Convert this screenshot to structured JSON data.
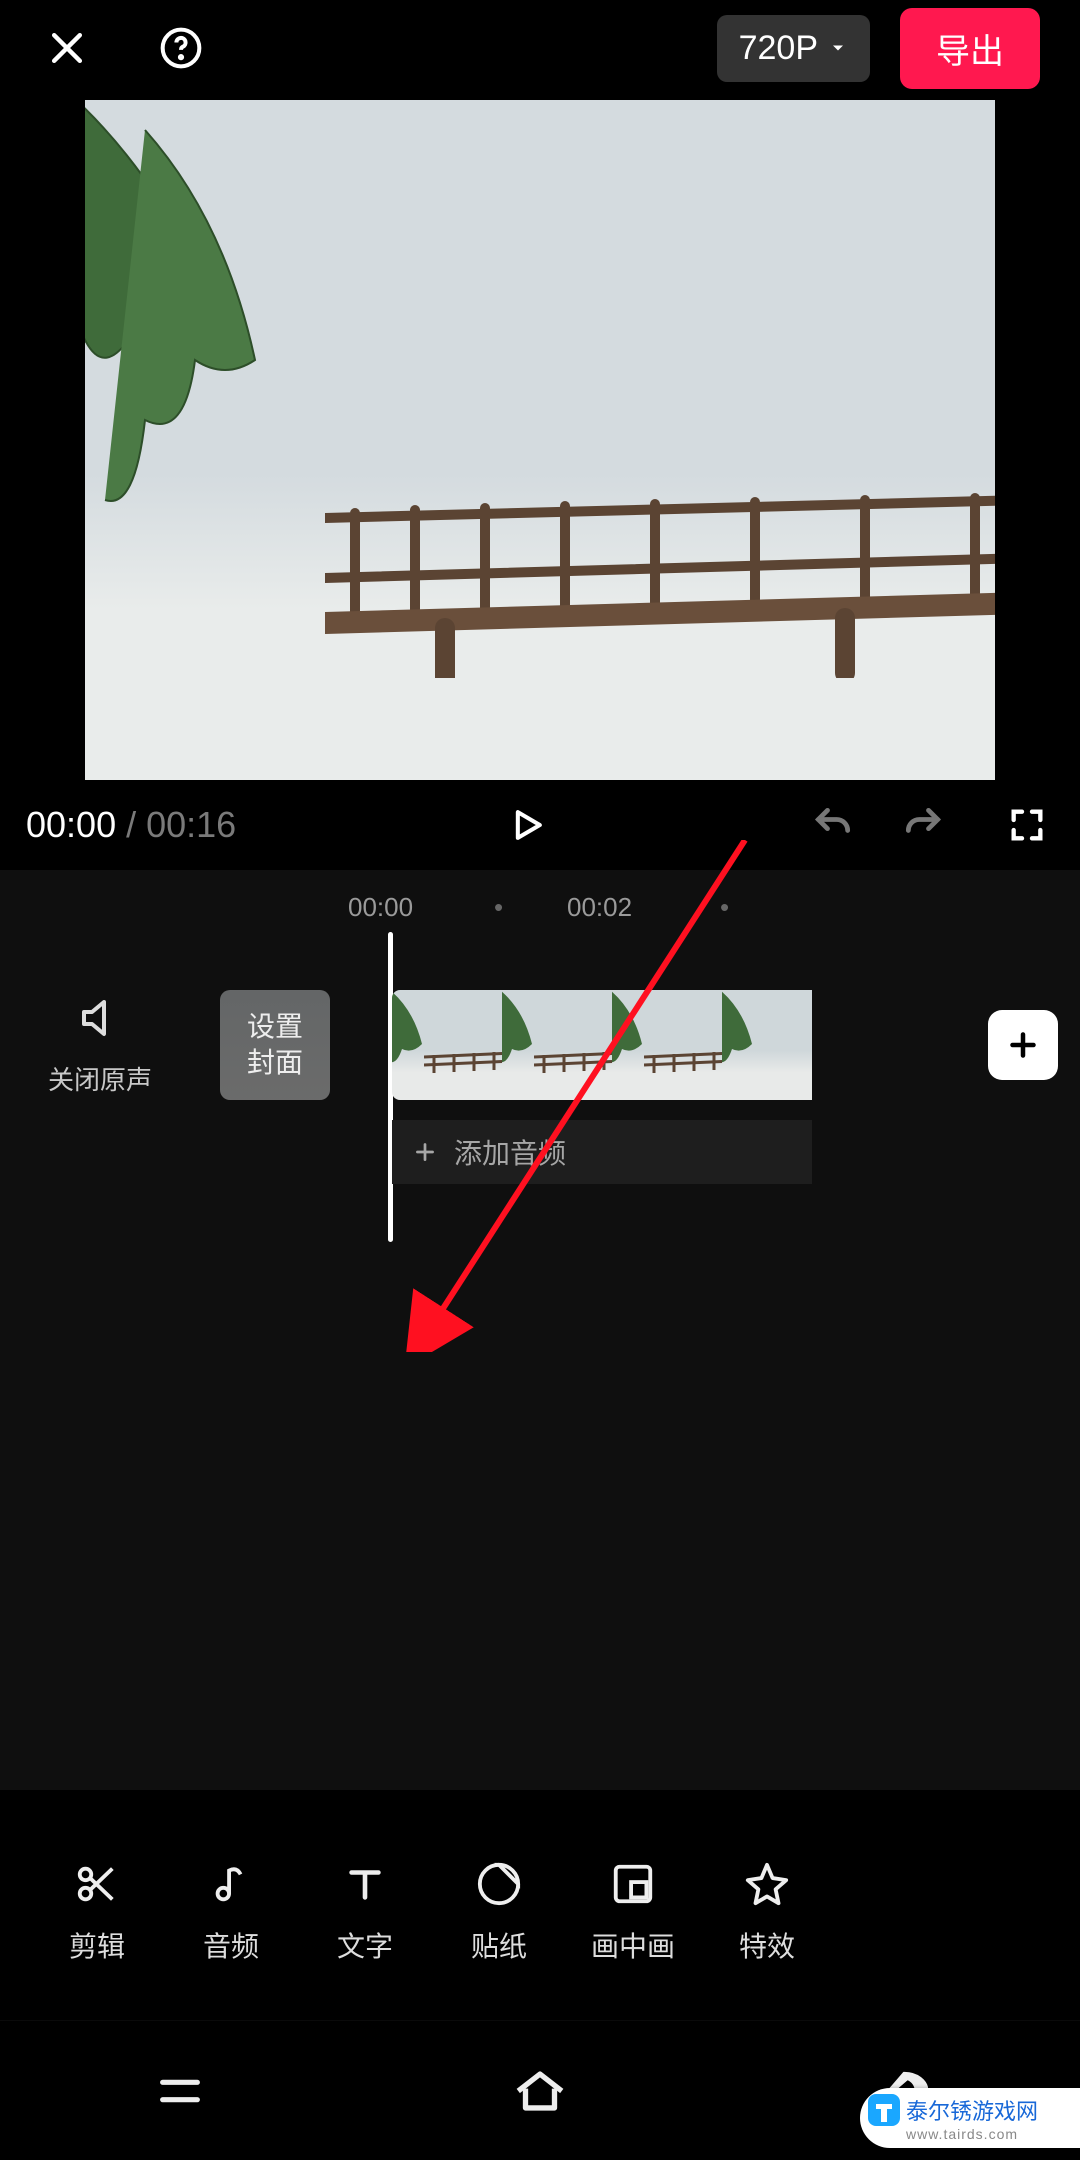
{
  "header": {
    "close_icon": "close",
    "help_icon": "help",
    "resolution_label": "720P",
    "resolution_dropdown_icon": "chevron-down",
    "export_label": "导出"
  },
  "playback": {
    "current_time": "00:00",
    "separator": "/",
    "total_time": "00:16",
    "play_icon": "play",
    "undo_icon": "undo",
    "redo_icon": "redo",
    "fullscreen_icon": "fullscreen"
  },
  "timeline": {
    "ruler": {
      "t0": "00:00",
      "t2": "00:02"
    },
    "mute": {
      "icon": "speaker-off",
      "label": "关闭原声"
    },
    "cover_button": {
      "line1": "设置",
      "line2": "封面"
    },
    "add_clip_icon": "plus",
    "audio_lane": {
      "icon": "plus",
      "label": "添加音频"
    }
  },
  "toolbar": {
    "items": [
      {
        "id": "edit",
        "icon": "scissors",
        "label": "剪辑"
      },
      {
        "id": "audio",
        "icon": "music-note",
        "label": "音频"
      },
      {
        "id": "text",
        "icon": "text",
        "label": "文字"
      },
      {
        "id": "sticker",
        "icon": "sticker",
        "label": "贴纸"
      },
      {
        "id": "pip",
        "icon": "pip",
        "label": "画中画"
      },
      {
        "id": "fx",
        "icon": "star",
        "label": "特效"
      }
    ]
  },
  "navbar": {
    "menu_icon": "menu",
    "home_icon": "home",
    "back_icon": "back"
  },
  "watermark": {
    "title": "泰尔锈游戏网",
    "subtitle": "www.tairds.com"
  },
  "colors": {
    "accent": "#ff184f",
    "background": "#000000"
  }
}
